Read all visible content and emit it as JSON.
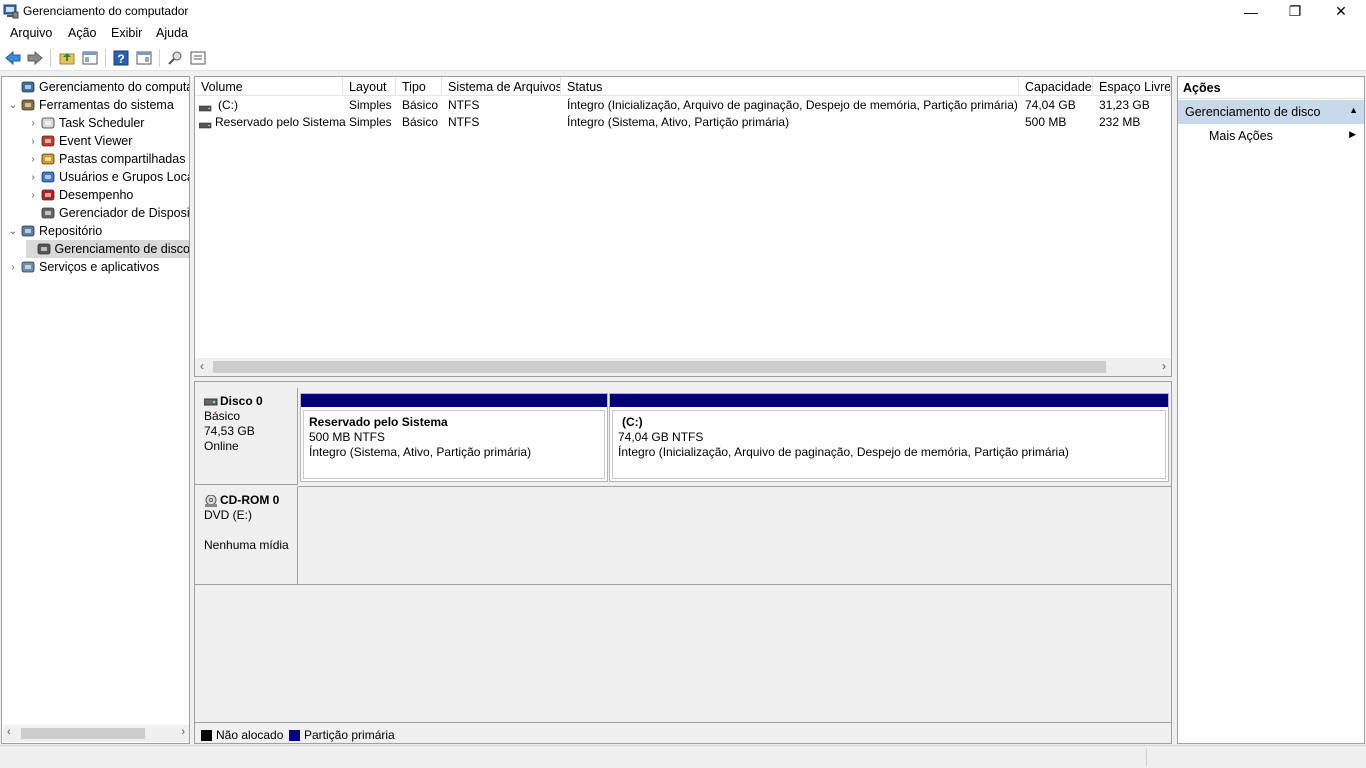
{
  "window": {
    "title": "Gerenciamento do computador",
    "buttons": {
      "minimize": "—",
      "restore": "❐",
      "close": "✕"
    }
  },
  "menu": [
    "Arquivo",
    "Ação",
    "Exibir",
    "Ajuda"
  ],
  "toolbar": {
    "icons": [
      "back-icon",
      "forward-icon",
      "up-folder-icon",
      "show-hide-tree-icon",
      "help-icon",
      "show-hide-action-icon",
      "connect-icon",
      "properties-icon"
    ]
  },
  "tree": {
    "items": [
      {
        "label": "Gerenciamento do computado",
        "icon": "computer-management-icon",
        "level": 0,
        "chev": ""
      },
      {
        "label": "Ferramentas do sistema",
        "icon": "system-tools-icon",
        "level": 1,
        "chev": "⌄"
      },
      {
        "label": "Task Scheduler",
        "icon": "clock-icon",
        "level": 2,
        "chev": "›"
      },
      {
        "label": "Event Viewer",
        "icon": "event-viewer-icon",
        "level": 2,
        "chev": "›"
      },
      {
        "label": "Pastas compartilhadas",
        "icon": "shared-folders-icon",
        "level": 2,
        "chev": "›"
      },
      {
        "label": "Usuários e Grupos Loca",
        "icon": "users-icon",
        "level": 2,
        "chev": "›"
      },
      {
        "label": "Desempenho",
        "icon": "performance-icon",
        "level": 2,
        "chev": "›"
      },
      {
        "label": "Gerenciador de Disposit",
        "icon": "device-manager-icon",
        "level": 2,
        "chev": ""
      },
      {
        "label": "Repositório",
        "icon": "storage-icon",
        "level": 1,
        "chev": "⌄"
      },
      {
        "label": "Gerenciamento de disco",
        "icon": "disk-management-icon",
        "level": 2,
        "chev": "",
        "selected": true
      },
      {
        "label": "Serviços e aplicativos",
        "icon": "services-icon",
        "level": 1,
        "chev": "›"
      }
    ]
  },
  "volumes": {
    "columns": [
      "Volume",
      "Layout",
      "Tipo",
      "Sistema de Arquivos",
      "Status",
      "Capacidade",
      "Espaço Livre"
    ],
    "rows": [
      [
        "(C:)",
        "Simples",
        "Básico",
        "NTFS",
        "Íntegro (Inicialização, Arquivo de paginação, Despejo de memória, Partição primária)",
        "74,04 GB",
        "31,23 GB"
      ],
      [
        "Reservado pelo Sistema",
        "Simples",
        "Básico",
        "NTFS",
        "Íntegro (Sistema, Ativo, Partição primária)",
        "500 MB",
        "232 MB"
      ]
    ]
  },
  "disks": [
    {
      "name": "Disco 0",
      "type": "Básico",
      "size": "74,53 GB",
      "state": "Online",
      "partitions": [
        {
          "name": "Reservado pelo Sistema",
          "size": "500 MB NTFS",
          "status": "Íntegro (Sistema, Ativo, Partição primária)"
        },
        {
          "name": "(C:)",
          "size": "74,04 GB NTFS",
          "status": "Íntegro (Inicialização, Arquivo de paginação, Despejo de memória, Partição primária)"
        }
      ]
    },
    {
      "name": "CD-ROM 0",
      "type": "DVD (E:)",
      "media": "Nenhuma mídia"
    }
  ],
  "legend": [
    {
      "label": "Não alocado",
      "color": "#000000"
    },
    {
      "label": "Partição primária",
      "color": "#00007f"
    }
  ],
  "actions": {
    "header": "Ações",
    "group": "Gerenciamento de disco",
    "more": "Mais Ações"
  },
  "colors": {
    "selection_group": "#c9d9ec",
    "partition_bar": "#00007f"
  }
}
